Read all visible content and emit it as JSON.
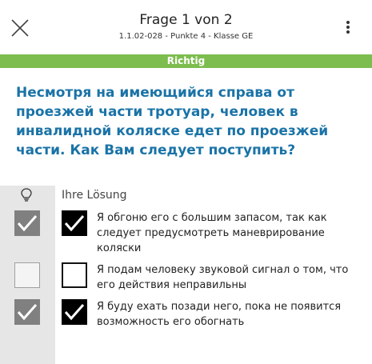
{
  "header": {
    "title": "Frage 1 von 2",
    "subtitle": "1.1.02-028 - Punkte 4 - Klasse GE"
  },
  "status": {
    "label": "Richtig",
    "color": "#7dbd4f"
  },
  "question": {
    "text": "Несмотря на имеющийся справа от проезжей части тротуар, человек в инвалидной коляске едет по проезжей части. Как Вам следует поступить?",
    "color": "#1a73a7"
  },
  "solution": {
    "header": "Ihre Lösung",
    "hint_icon": "lightbulb-icon"
  },
  "answers": [
    {
      "text": "Я обгоню его с большим запасом, так как следует предусмотреть маневрирование коляски",
      "correct": true,
      "selected": true
    },
    {
      "text": "Я подам человеку звуковой сигнал о том, что его действия неправильны",
      "correct": false,
      "selected": false
    },
    {
      "text": "Я буду ехать позади него, пока не появится возможность его обогнать",
      "correct": true,
      "selected": true
    }
  ]
}
